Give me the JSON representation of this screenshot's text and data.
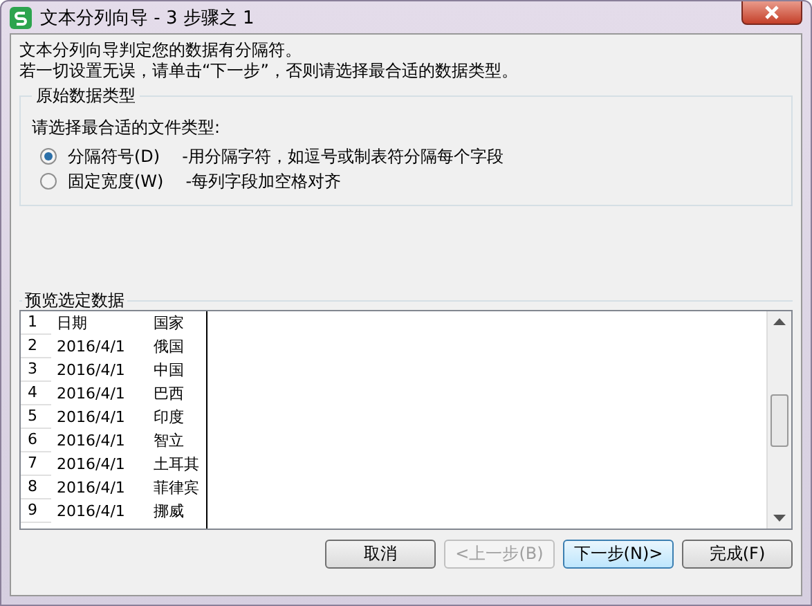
{
  "window": {
    "title": "文本分列向导 - 3 步骤之 1"
  },
  "intro": [
    "文本分列向导判定您的数据有分隔符。",
    "若一切设置无误，请单击“下一步”，否则请选择最合适的数据类型。"
  ],
  "group": {
    "title": "原始数据类型",
    "prompt": "请选择最合适的文件类型:",
    "options": [
      {
        "label": "分隔符号(D)",
        "description": "-用分隔字符，如逗号或制表符分隔每个字段",
        "selected": true
      },
      {
        "label": "固定宽度(W)",
        "description": "-每列字段加空格对齐",
        "selected": false
      }
    ]
  },
  "preview": {
    "title": "预览选定数据",
    "rows": [
      {
        "number": "1",
        "column_1": "日期",
        "column_2": "国家"
      },
      {
        "number": "2",
        "column_1": "2016/4/1",
        "column_2": "俄国"
      },
      {
        "number": "3",
        "column_1": "2016/4/1",
        "column_2": "中国"
      },
      {
        "number": "4",
        "column_1": "2016/4/1",
        "column_2": "巴西"
      },
      {
        "number": "5",
        "column_1": "2016/4/1",
        "column_2": "印度"
      },
      {
        "number": "6",
        "column_1": "2016/4/1",
        "column_2": "智立"
      },
      {
        "number": "7",
        "column_1": "2016/4/1",
        "column_2": "土耳其"
      },
      {
        "number": "8",
        "column_1": "2016/4/1",
        "column_2": "菲律宾"
      },
      {
        "number": "9",
        "column_1": "2016/4/1",
        "column_2": "挪威"
      }
    ]
  },
  "buttons": [
    {
      "label": "取消",
      "disabled": false,
      "focused": false
    },
    {
      "label": "<上一步(B)",
      "disabled": true,
      "focused": false
    },
    {
      "label": "下一步(N)>",
      "disabled": false,
      "focused": true
    },
    {
      "label": "完成(F)",
      "disabled": false,
      "focused": false
    }
  ]
}
